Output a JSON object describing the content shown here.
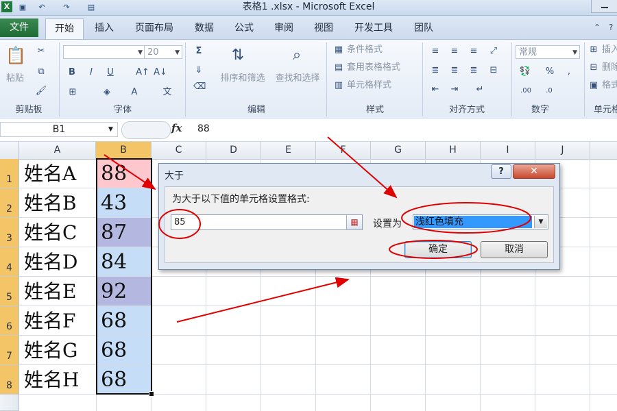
{
  "window": {
    "title": "表格1 .xlsx - Microsoft Excel",
    "app_icon": "excel-x-icon",
    "app_icon_letter": "X"
  },
  "quick_access": [
    {
      "icon": "save-icon",
      "glyph": "▣"
    },
    {
      "icon": "undo-icon",
      "glyph": "↶"
    },
    {
      "icon": "redo-icon",
      "glyph": "↷"
    },
    {
      "icon": "print-preview-icon",
      "glyph": "▤"
    }
  ],
  "tabs": [
    "文件",
    "开始",
    "插入",
    "页面布局",
    "数据",
    "公式",
    "审阅",
    "视图",
    "开发工具",
    "团队"
  ],
  "active_tab": "开始",
  "ribbon": {
    "clipboard": {
      "label": "剪贴板",
      "paste": "粘贴"
    },
    "font": {
      "label": "字体",
      "font_name": "",
      "font_size": "20",
      "bold": "B",
      "italic": "I",
      "underline": "U"
    },
    "editing": {
      "label": "编辑",
      "sort_filter": "排序和筛选",
      "find_select": "查找和选择",
      "sum": "Σ"
    },
    "styles": {
      "label": "样式",
      "conditional_format": "条件格式",
      "table_format": "套用表格格式",
      "cell_styles": "单元格样式"
    },
    "alignment": {
      "label": "对齐方式"
    },
    "number": {
      "label": "数字",
      "format": "常规",
      "percent": "%"
    },
    "cells": {
      "label": "单元格",
      "insert": "插入",
      "delete": "删除",
      "format": "格式"
    }
  },
  "formula_bar": {
    "name_box": "B1",
    "fx": "fx",
    "value": "88"
  },
  "sheet": {
    "columns": [
      "A",
      "B",
      "C",
      "D",
      "E",
      "F",
      "G",
      "H",
      "I",
      "J"
    ],
    "rows": [
      {
        "num": "1",
        "a": "姓名A",
        "b": "88",
        "fill": "#ffc7ce"
      },
      {
        "num": "2",
        "a": "姓名B",
        "b": "43",
        "fill": "#c5ddf7"
      },
      {
        "num": "3",
        "a": "姓名C",
        "b": "87",
        "fill": "#b4b7e0"
      },
      {
        "num": "4",
        "a": "姓名D",
        "b": "84",
        "fill": "#c5ddf7"
      },
      {
        "num": "5",
        "a": "姓名E",
        "b": "92",
        "fill": "#b4b7e0"
      },
      {
        "num": "6",
        "a": "姓名F",
        "b": "68",
        "fill": "#c5ddf7"
      },
      {
        "num": "7",
        "a": "姓名G",
        "b": "68",
        "fill": "#c5ddf7"
      },
      {
        "num": "8",
        "a": "姓名H",
        "b": "68",
        "fill": "#c5ddf7"
      }
    ]
  },
  "dialog": {
    "title": "大于",
    "help": "?",
    "close": "✕",
    "prompt": "为大于以下值的单元格设置格式:",
    "value": "85",
    "set_as_label": "设置为",
    "format_selected": "浅红色填充",
    "ok": "确定",
    "cancel": "取消"
  },
  "colors": {
    "annotation_red": "#e00000",
    "selection_header": "#f4c567"
  }
}
